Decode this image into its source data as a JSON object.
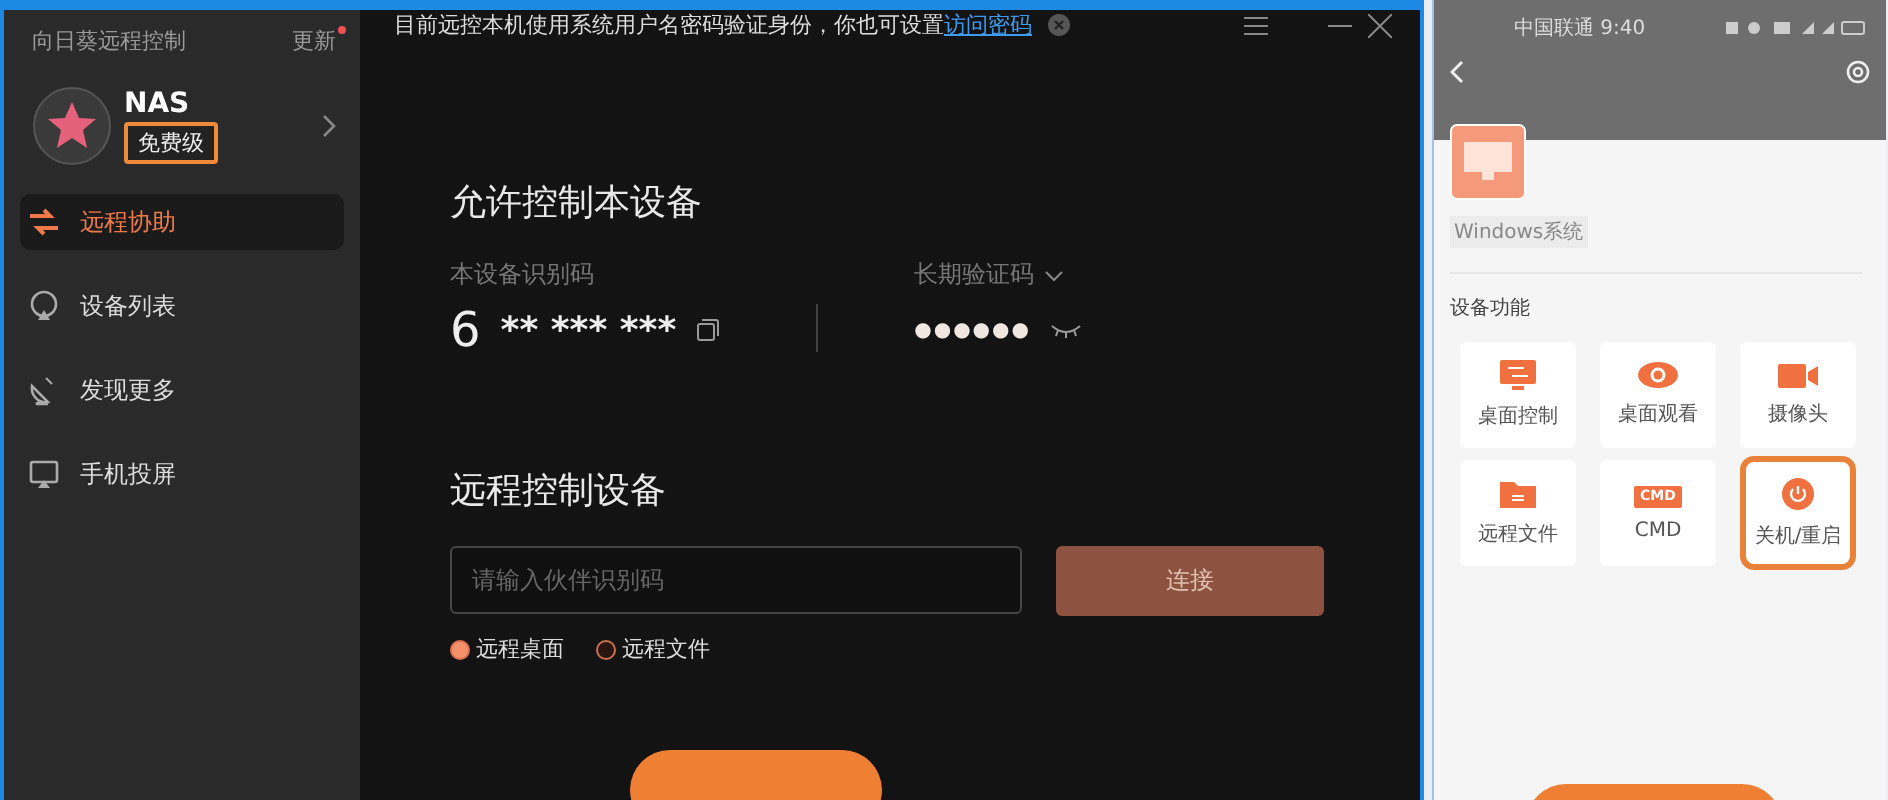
{
  "app": {
    "title": "向日葵远程控制",
    "update": "更新",
    "update_dot": true
  },
  "account": {
    "name": "NAS",
    "tier": "免费级",
    "tier_highlighted": true
  },
  "sidebar": {
    "items": [
      {
        "label": "远程协助",
        "kind": "arrows",
        "selected": true
      },
      {
        "label": "设备列表",
        "kind": "device",
        "selected": false
      },
      {
        "label": "发现更多",
        "kind": "dish",
        "selected": false
      },
      {
        "label": "手机投屏",
        "kind": "screen",
        "selected": false
      }
    ]
  },
  "notice": {
    "text": "目前远控本机使用系统用户名密码验证身份，你也可设置",
    "link": "访问密码"
  },
  "allow": {
    "title": "允许控制本设备",
    "id_label": "本设备识别码",
    "id_first": "6",
    "id_masked": "** *** ***",
    "code_label": "长期验证码",
    "code_masked": "●●●●●●"
  },
  "remote": {
    "title": "远程控制设备",
    "placeholder": "请输入伙伴识别码",
    "connect": "连接",
    "options": [
      {
        "label": "远程桌面",
        "selected": true
      },
      {
        "label": "远程文件",
        "selected": false
      }
    ]
  },
  "phone": {
    "status_left": "中国联通 9:40",
    "os_tag": "Windows系统",
    "section": "设备功能",
    "tiles": [
      {
        "label": "桌面控制",
        "kind": "control",
        "highlighted": false
      },
      {
        "label": "桌面观看",
        "kind": "view",
        "highlighted": false
      },
      {
        "label": "摄像头",
        "kind": "camera",
        "highlighted": false
      },
      {
        "label": "远程文件",
        "kind": "folder",
        "highlighted": false
      },
      {
        "label": "CMD",
        "kind": "cmd",
        "icon_text": "CMD",
        "highlighted": false
      },
      {
        "label": "关机/重启",
        "kind": "power",
        "highlighted": true
      }
    ]
  }
}
